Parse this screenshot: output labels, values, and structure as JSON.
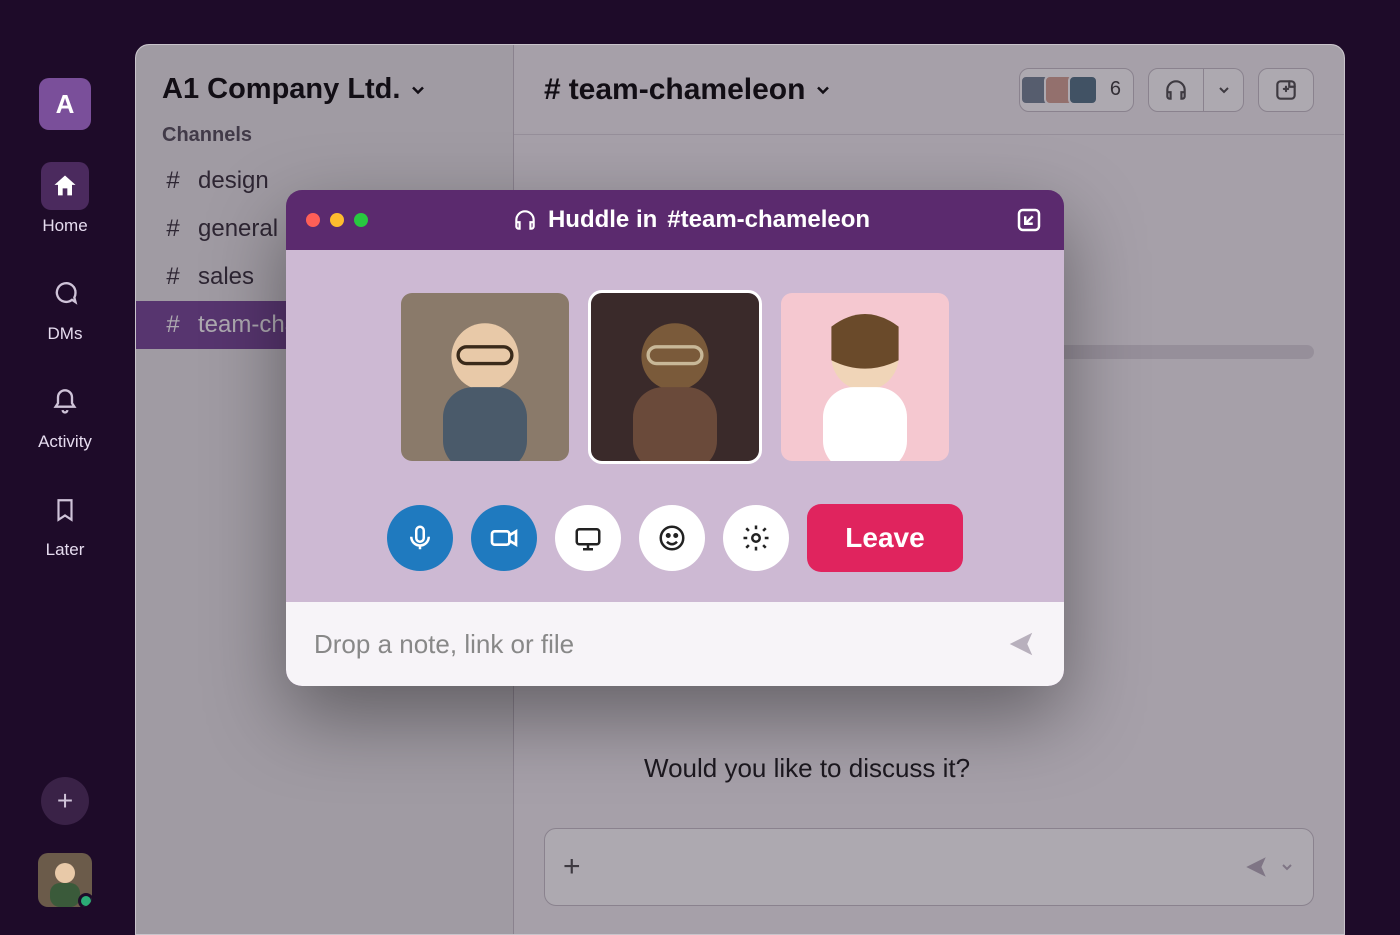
{
  "workspace": {
    "letter": "A",
    "name": "A1 Company Ltd."
  },
  "rail": {
    "home": "Home",
    "dms": "DMs",
    "activity": "Activity",
    "later": "Later"
  },
  "sidebar": {
    "section_channels": "Channels",
    "channels": [
      {
        "name": "design"
      },
      {
        "name": "general"
      },
      {
        "name": "sales"
      },
      {
        "name": "team-chameleon"
      }
    ],
    "active_index": 3
  },
  "channel_header": {
    "name": "team-chameleon",
    "member_count": "6"
  },
  "message_visible": "Would you like to discuss it?",
  "huddle": {
    "title_prefix": "Huddle in",
    "channel": "#team-chameleon",
    "leave_label": "Leave",
    "note_placeholder": "Drop a note, link or file"
  }
}
